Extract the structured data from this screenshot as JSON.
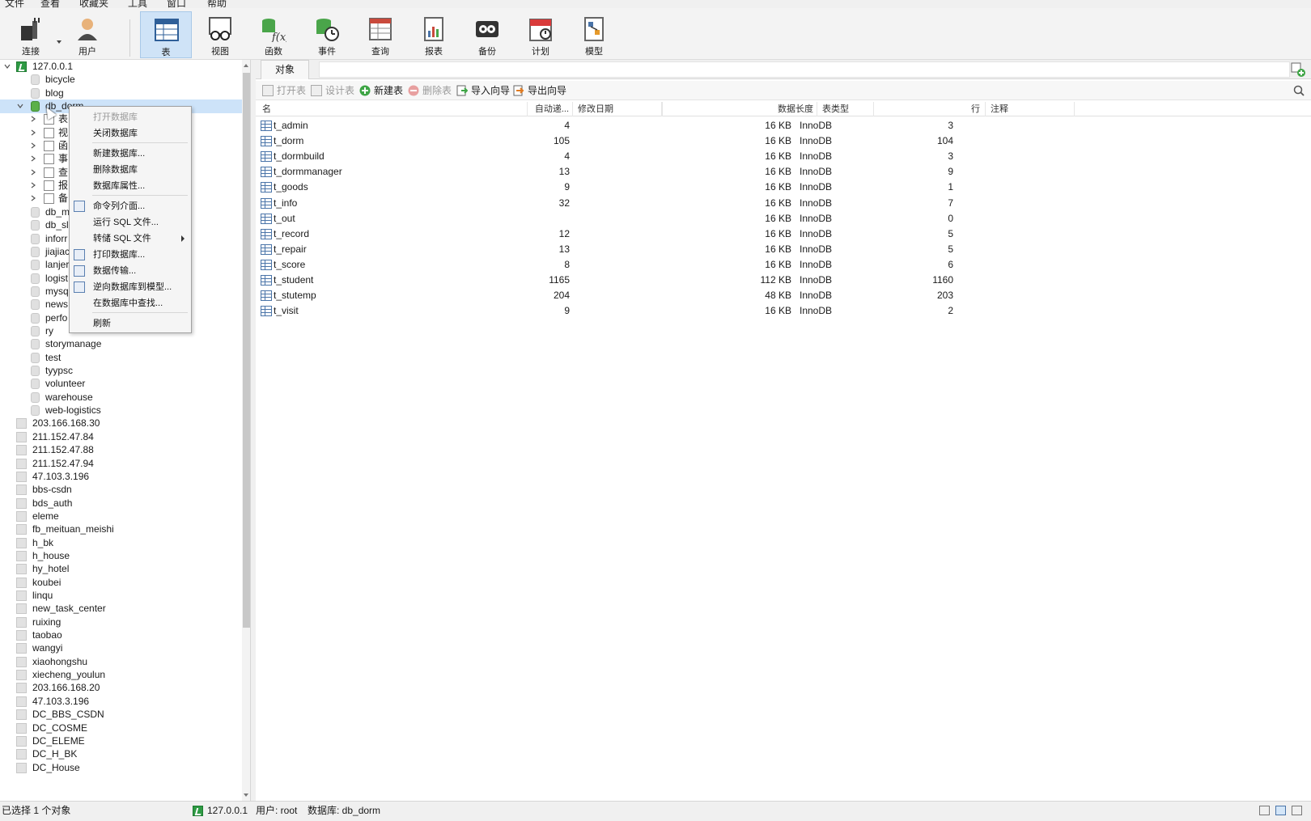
{
  "menubar": [
    "文件",
    "查看",
    "收藏夹",
    "工具",
    "窗口",
    "帮助"
  ],
  "toolbar": {
    "connect": "连接",
    "user": "用户",
    "table": "表",
    "view": "视图",
    "function": "函数",
    "event": "事件",
    "query": "查询",
    "report": "报表",
    "backup": "备份",
    "schedule": "计划",
    "model": "模型"
  },
  "tree": {
    "root": "127.0.0.1",
    "dbs_before": [
      "bicycle",
      "blog"
    ],
    "selected_db": "db_dorm",
    "children": [
      {
        "prefix": "表",
        "icon": "table-icon"
      },
      {
        "prefix": "视",
        "icon": "view-icon"
      },
      {
        "prefix": "函",
        "icon": "function-icon"
      },
      {
        "prefix": "事",
        "icon": "event-icon"
      },
      {
        "prefix": "查",
        "icon": "query-icon"
      },
      {
        "prefix": "报",
        "icon": "report-icon"
      },
      {
        "prefix": "备",
        "icon": "backup-icon"
      }
    ],
    "dbs_after_partial": [
      "db_m",
      "db_sl",
      "inforr",
      "jiajiac",
      "lanjer",
      "logist",
      "mysq",
      "news",
      "perfo"
    ],
    "dbs_after": [
      "ry",
      "storymanage",
      "test",
      "tyypsc",
      "volunteer",
      "warehouse",
      "web-logistics"
    ],
    "connections": [
      "203.166.168.30",
      "211.152.47.84",
      "211.152.47.88",
      "211.152.47.94",
      "47.103.3.196",
      "bbs-csdn",
      "bds_auth",
      "eleme",
      "fb_meituan_meishi",
      "h_bk",
      "h_house",
      "hy_hotel",
      "koubei",
      "linqu",
      "new_task_center",
      "ruixing",
      "taobao",
      "wangyi",
      "xiaohongshu",
      "xiecheng_youlun",
      "203.166.168.20",
      "47.103.3.196",
      "DC_BBS_CSDN",
      "DC_COSME",
      "DC_ELEME",
      "DC_H_BK",
      "DC_House"
    ]
  },
  "context_menu": {
    "items": [
      {
        "label": "打开数据库",
        "disabled": true
      },
      {
        "label": "关闭数据库",
        "disabled": false
      },
      {
        "label": "新建数据库...",
        "disabled": false
      },
      {
        "label": "删除数据库",
        "disabled": false
      },
      {
        "label": "数据库属性...",
        "disabled": false
      },
      {
        "label": "命令列介面...",
        "disabled": false
      },
      {
        "label": "运行 SQL 文件...",
        "disabled": false
      },
      {
        "label": "转储 SQL 文件",
        "disabled": false
      },
      {
        "label": "打印数据库...",
        "disabled": false
      },
      {
        "label": "数据传输...",
        "disabled": false
      },
      {
        "label": "逆向数据库到模型...",
        "disabled": false
      },
      {
        "label": "在数据库中查找...",
        "disabled": false
      },
      {
        "label": "刷新",
        "disabled": false
      }
    ]
  },
  "objects": {
    "tab": "对象",
    "toolbar": {
      "open": "打开表",
      "design": "设计表",
      "new": "新建表",
      "delete": "删除表",
      "import": "导入向导",
      "export": "导出向导"
    },
    "columns": {
      "name": "名",
      "auto_inc": "自动递...",
      "modified": "修改日期",
      "data_len": "数据长度",
      "engine": "表类型",
      "rows": "行",
      "comment": "注释"
    },
    "rows": [
      {
        "name": "t_admin",
        "auto_inc": "4",
        "data_len": "16 KB",
        "engine": "InnoDB",
        "rows": "3"
      },
      {
        "name": "t_dorm",
        "auto_inc": "105",
        "data_len": "16 KB",
        "engine": "InnoDB",
        "rows": "104"
      },
      {
        "name": "t_dormbuild",
        "auto_inc": "4",
        "data_len": "16 KB",
        "engine": "InnoDB",
        "rows": "3"
      },
      {
        "name": "t_dormmanager",
        "auto_inc": "13",
        "data_len": "16 KB",
        "engine": "InnoDB",
        "rows": "9"
      },
      {
        "name": "t_goods",
        "auto_inc": "9",
        "data_len": "16 KB",
        "engine": "InnoDB",
        "rows": "1"
      },
      {
        "name": "t_info",
        "auto_inc": "32",
        "data_len": "16 KB",
        "engine": "InnoDB",
        "rows": "7"
      },
      {
        "name": "t_out",
        "auto_inc": "",
        "data_len": "16 KB",
        "engine": "InnoDB",
        "rows": "0"
      },
      {
        "name": "t_record",
        "auto_inc": "12",
        "data_len": "16 KB",
        "engine": "InnoDB",
        "rows": "5"
      },
      {
        "name": "t_repair",
        "auto_inc": "13",
        "data_len": "16 KB",
        "engine": "InnoDB",
        "rows": "5"
      },
      {
        "name": "t_score",
        "auto_inc": "8",
        "data_len": "16 KB",
        "engine": "InnoDB",
        "rows": "6"
      },
      {
        "name": "t_student",
        "auto_inc": "1165",
        "data_len": "112 KB",
        "engine": "InnoDB",
        "rows": "1160"
      },
      {
        "name": "t_stutemp",
        "auto_inc": "204",
        "data_len": "48 KB",
        "engine": "InnoDB",
        "rows": "203"
      },
      {
        "name": "t_visit",
        "auto_inc": "9",
        "data_len": "16 KB",
        "engine": "InnoDB",
        "rows": "2"
      }
    ]
  },
  "status": {
    "selected": "已选择 1 个对象",
    "host": "127.0.0.1",
    "user": "用户: root",
    "database": "数据库: db_dorm"
  }
}
